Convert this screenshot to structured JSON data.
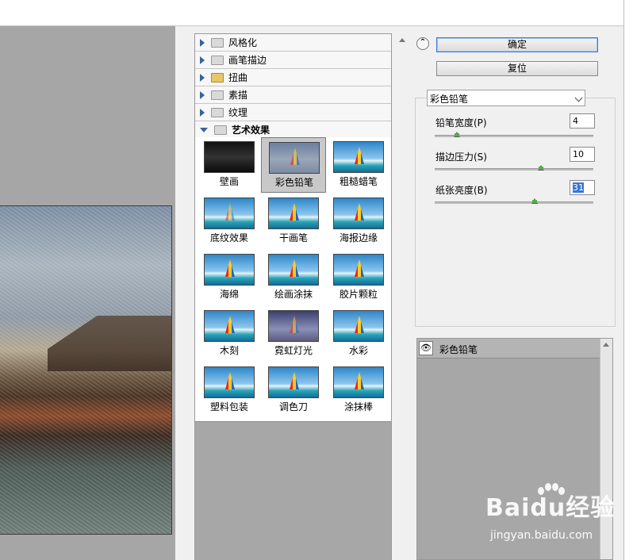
{
  "filter_categories": [
    {
      "label": "风格化",
      "expanded": false
    },
    {
      "label": "画笔描边",
      "expanded": false
    },
    {
      "label": "扭曲",
      "expanded": false
    },
    {
      "label": "素描",
      "expanded": false
    },
    {
      "label": "纹理",
      "expanded": false
    },
    {
      "label": "艺术效果",
      "expanded": true
    }
  ],
  "artistic_filters": [
    {
      "label": "壁画",
      "selected": false
    },
    {
      "label": "彩色铅笔",
      "selected": true
    },
    {
      "label": "粗糙蜡笔",
      "selected": false
    },
    {
      "label": "底纹效果",
      "selected": false
    },
    {
      "label": "干画笔",
      "selected": false
    },
    {
      "label": "海报边缘",
      "selected": false
    },
    {
      "label": "海绵",
      "selected": false
    },
    {
      "label": "绘画涂抹",
      "selected": false
    },
    {
      "label": "胶片颗粒",
      "selected": false
    },
    {
      "label": "木刻",
      "selected": false
    },
    {
      "label": "霓虹灯光",
      "selected": false
    },
    {
      "label": "水彩",
      "selected": false
    },
    {
      "label": "塑料包装",
      "selected": false
    },
    {
      "label": "调色刀",
      "selected": false
    },
    {
      "label": "涂抹棒",
      "selected": false
    }
  ],
  "buttons": {
    "ok": "确定",
    "reset": "复位"
  },
  "filter_dropdown": {
    "selected": "彩色铅笔"
  },
  "params": [
    {
      "label": "铅笔宽度(P)",
      "value": "4",
      "slider_fraction": 0.14
    },
    {
      "label": "描边压力(S)",
      "value": "10",
      "slider_fraction": 0.67
    },
    {
      "label": "纸张亮度(B)",
      "value": "31",
      "slider_fraction": 0.63,
      "focused": true
    }
  ],
  "effect_layers": [
    {
      "label": "彩色铅笔",
      "visible": true
    }
  ],
  "watermark": {
    "brand": "Baidu经验",
    "url": "jingyan.baidu.com"
  }
}
